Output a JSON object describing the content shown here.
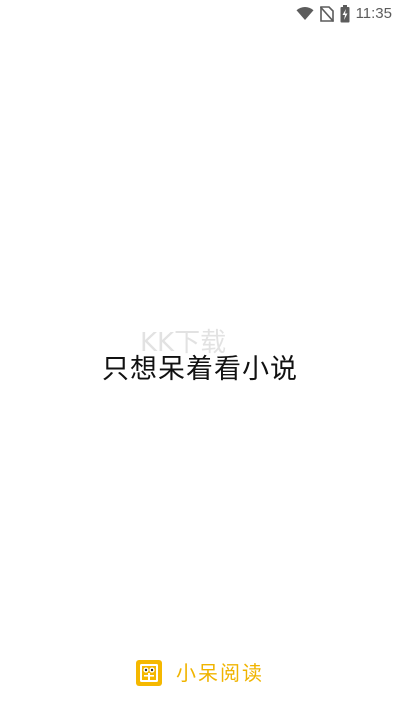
{
  "status_bar": {
    "time": "11:35",
    "icons": [
      "wifi-icon",
      "no-sim-icon",
      "battery-charging-icon"
    ]
  },
  "splash": {
    "tagline": "只想呆着看小说",
    "watermark": "KK下载"
  },
  "brand": {
    "logo_icon": "book-face-logo-icon",
    "name": "小呆阅读",
    "accent_color": "#F0B400"
  },
  "colors": {
    "background": "#FFFFFF",
    "tagline": "#111111",
    "status_icon": "#5C5C5C"
  }
}
